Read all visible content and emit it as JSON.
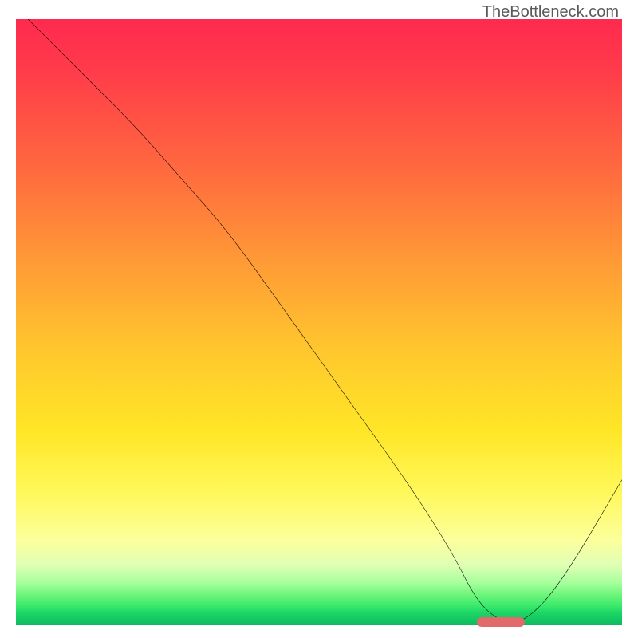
{
  "watermark": "TheBottleneck.com",
  "chart_data": {
    "type": "line",
    "title": "",
    "xlabel": "",
    "ylabel": "",
    "xlim": [
      0,
      100
    ],
    "ylim": [
      0,
      100
    ],
    "series": [
      {
        "name": "curve",
        "x": [
          2,
          10,
          20,
          27,
          35,
          45,
          55,
          65,
          72,
          76,
          80,
          84,
          90,
          100
        ],
        "y": [
          100,
          92,
          82,
          74,
          65,
          51,
          37,
          23,
          12,
          4,
          0.5,
          0.5,
          7,
          24
        ]
      }
    ],
    "marker": {
      "x_start": 76,
      "x_end": 84,
      "y": 0.5
    },
    "colors": {
      "curve": "#000000",
      "marker": "#e26a6a",
      "gradient_top": "#ff2a4f",
      "gradient_mid": "#ffe627",
      "gradient_bottom": "#0eb85f"
    }
  }
}
